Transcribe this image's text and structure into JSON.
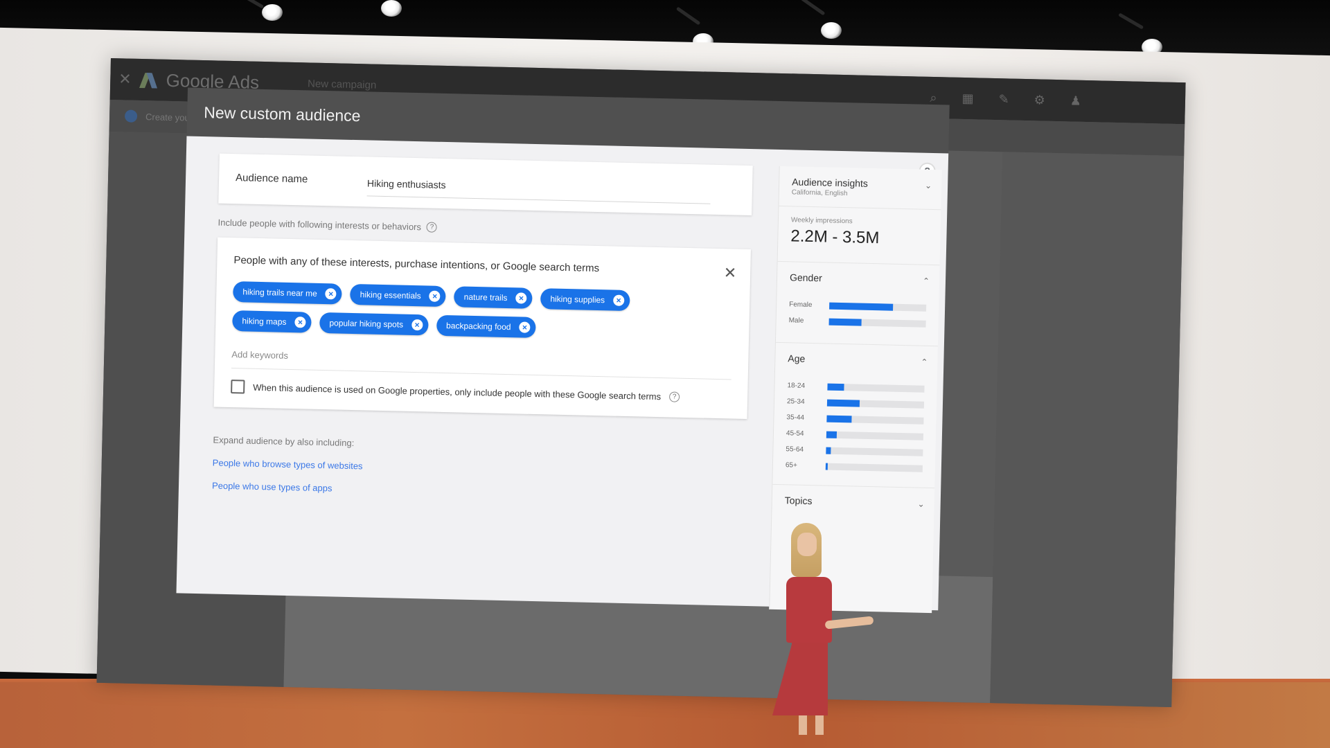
{
  "app": {
    "product_name": "Google Ads",
    "subtitle": "New campaign",
    "subbar_text": "Create your"
  },
  "dialog": {
    "title": "New custom audience",
    "audience_name_label": "Audience name",
    "audience_name_value": "Hiking enthusiasts",
    "include_label": "Include people with following interests or behaviors",
    "interest_card_title": "People with any of these interests, purchase intentions, or Google search terms",
    "chips": [
      "hiking trails near me",
      "hiking essentials",
      "nature trails",
      "hiking supplies",
      "hiking maps",
      "popular hiking spots",
      "backpacking food"
    ],
    "add_keywords_placeholder": "Add keywords",
    "checkbox_label": "When this audience is used on Google properties, only include people with these Google search terms",
    "expand_label": "Expand audience by also including:",
    "expand_links": [
      "People who browse types of websites",
      "People who use types of apps"
    ]
  },
  "insights": {
    "title": "Audience insights",
    "subtitle": "California, English",
    "impressions_label": "Weekly impressions",
    "impressions_value": "2.2M - 3.5M",
    "gender_title": "Gender",
    "gender": [
      {
        "label": "Female",
        "value": 0.66
      },
      {
        "label": "Male",
        "value": 0.34
      }
    ],
    "age_title": "Age",
    "age": [
      {
        "label": "18-24",
        "value": 0.17
      },
      {
        "label": "25-34",
        "value": 0.34
      },
      {
        "label": "35-44",
        "value": 0.26
      },
      {
        "label": "45-54",
        "value": 0.11
      },
      {
        "label": "55-64",
        "value": 0.05
      },
      {
        "label": "65+",
        "value": 0.02
      }
    ],
    "topics_title": "Topics"
  },
  "colors": {
    "accent": "#1a73e8",
    "link": "#3b78e7",
    "stage_floor": "#c0693c",
    "dress": "#b83a3e"
  }
}
